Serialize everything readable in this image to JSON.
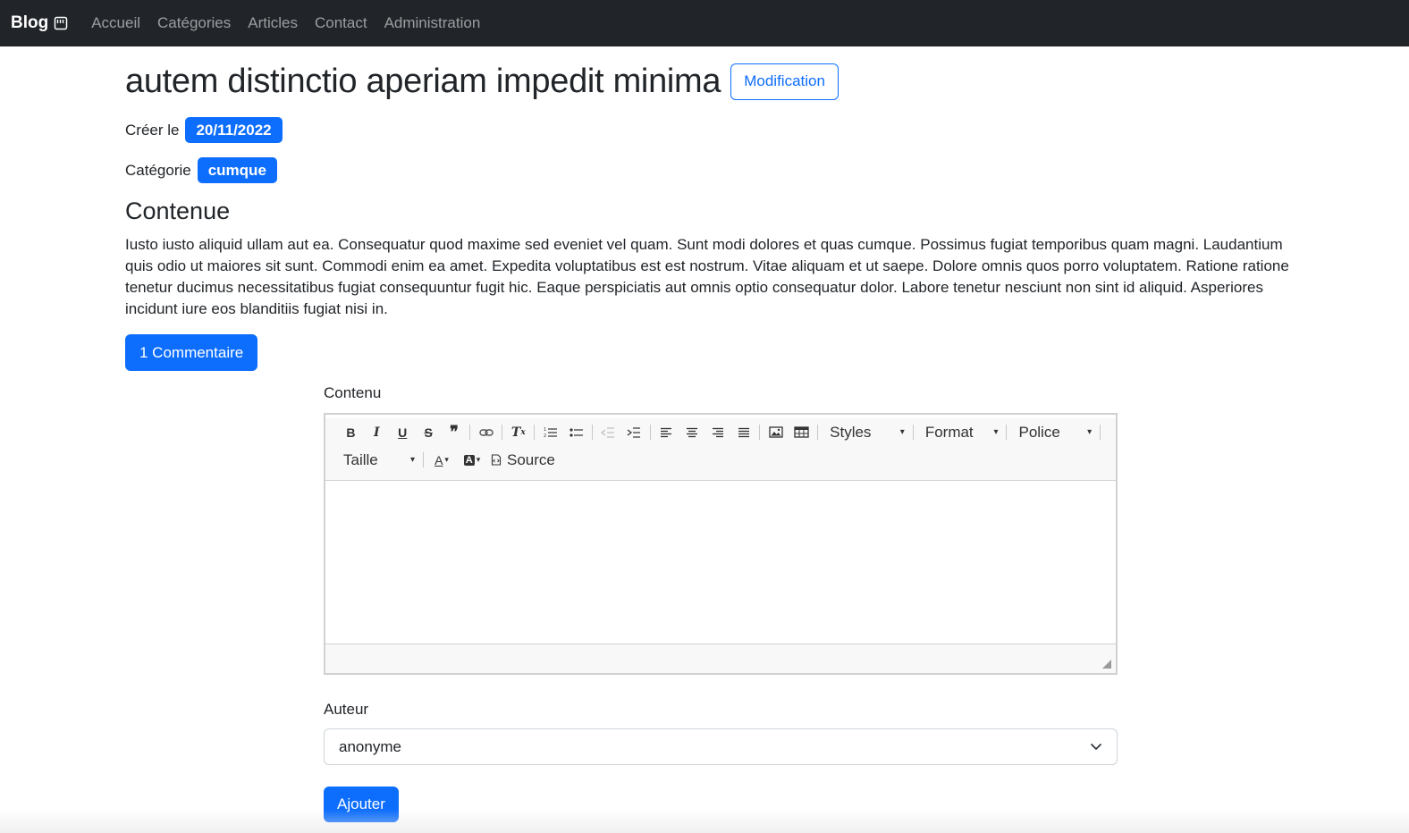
{
  "navbar": {
    "brand": "Blog",
    "brand_icon": "sticky-note-icon",
    "links": [
      "Accueil",
      "Catégories",
      "Articles",
      "Contact",
      "Administration"
    ]
  },
  "article": {
    "title": "autem distinctio aperiam impedit minima",
    "edit_label": "Modification",
    "created_label": "Créer le",
    "created_date": "20/11/2022",
    "category_label": "Catégorie",
    "category": "cumque",
    "content_heading": "Contenue",
    "content": "Iusto iusto aliquid ullam aut ea. Consequatur quod maxime sed eveniet vel quam. Sunt modi dolores et quas cumque. Possimus fugiat temporibus quam magni. Laudantium quis odio ut maiores sit sunt. Commodi enim ea amet. Expedita voluptatibus est est nostrum. Vitae aliquam et ut saepe. Dolore omnis quos porro voluptatem. Ratione ratione tenetur ducimus necessitatibus fugiat consequuntur fugit hic. Eaque perspiciatis aut omnis optio consequatur dolor. Labore tenetur nesciunt non sint id aliquid. Asperiores incidunt iure eos blanditiis fugiat nisi in.",
    "comments_button": "1 Commentaire"
  },
  "form": {
    "content_label": "Contenu",
    "editor": {
      "styles": "Styles",
      "format": "Format",
      "font": "Police",
      "size": "Taille",
      "source": "Source",
      "text_color_glyph": "A",
      "bg_color_glyph": "A"
    },
    "author_label": "Auteur",
    "author_value": "anonyme",
    "submit": "Ajouter"
  },
  "colors": {
    "navbar_bg": "#212529",
    "primary": "#0d6efd"
  }
}
